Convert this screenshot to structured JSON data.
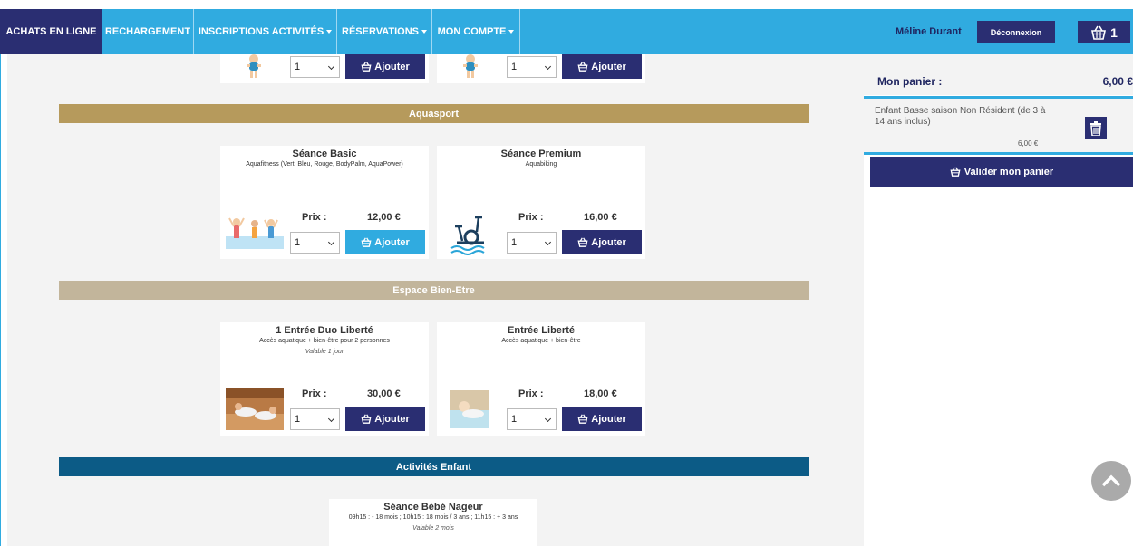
{
  "nav": {
    "items": [
      {
        "label": "ACHATS EN LIGNE",
        "dropdown": false
      },
      {
        "label": "RECHARGEMENT",
        "dropdown": false
      },
      {
        "label": "INSCRIPTIONS ACTIVITÉS",
        "dropdown": true
      },
      {
        "label": "RÉSERVATIONS",
        "dropdown": true
      },
      {
        "label": "MON COMPTE",
        "dropdown": true
      }
    ],
    "user_name": "Méline Durant",
    "logout_label": "Déconnexion",
    "cart_count": "1"
  },
  "colors": {
    "nav_bg": "#30abe0",
    "dark_blue": "#2a2e72",
    "aquasport": "#b69a5c",
    "bien_etre": "#c2b59b",
    "activites_enfant": "#0c5b86"
  },
  "catalog": {
    "top_row": {
      "cards": [
        {
          "qty": "1",
          "add_label": "Ajouter"
        },
        {
          "qty": "1",
          "add_label": "Ajouter"
        }
      ]
    },
    "sections": [
      {
        "title": "Aquasport",
        "cards": [
          {
            "title": "Séance Basic",
            "subtitle": "Aquafitness (Vert, Bleu, Rouge, BodyPalm, AquaPower)",
            "note": "",
            "price_label": "Prix :",
            "price": "12,00 €",
            "qty": "1",
            "add_label": "Ajouter",
            "image": "aquafitness-group-icon"
          },
          {
            "title": "Séance Premium",
            "subtitle": "Aquabiking",
            "note": "",
            "price_label": "Prix :",
            "price": "16,00 €",
            "qty": "1",
            "add_label": "Ajouter",
            "image": "aquabike-icon"
          }
        ]
      },
      {
        "title": "Espace Bien-Etre",
        "cards": [
          {
            "title": "1 Entrée Duo Liberté",
            "subtitle": "Accès aquatique + bien-être pour 2 personnes",
            "note": "Valable 1 jour",
            "price_label": "Prix :",
            "price": "30,00 €",
            "qty": "1",
            "add_label": "Ajouter",
            "image": "sauna-photo"
          },
          {
            "title": "Entrée Liberté",
            "subtitle": "Accès aquatique + bien-être",
            "note": "",
            "price_label": "Prix :",
            "price": "18,00 €",
            "qty": "1",
            "add_label": "Ajouter",
            "image": "spa-photo"
          }
        ]
      },
      {
        "title": "Activités Enfant",
        "cards": [
          {
            "title": "Séance Bébé Nageur",
            "subtitle": "09h15 : - 18 mois ; 10h15 : 18 mois / 3 ans ; 11h15 : + 3 ans",
            "note": "Valable 2 mois"
          }
        ]
      }
    ]
  },
  "cart": {
    "title": "Mon panier :",
    "total": "6,00 €",
    "items": [
      {
        "name": "Enfant Basse saison Non Résident (de 3 à 14 ans inclus)",
        "price": "6,00 €"
      }
    ],
    "validate_label": "Valider mon panier"
  }
}
